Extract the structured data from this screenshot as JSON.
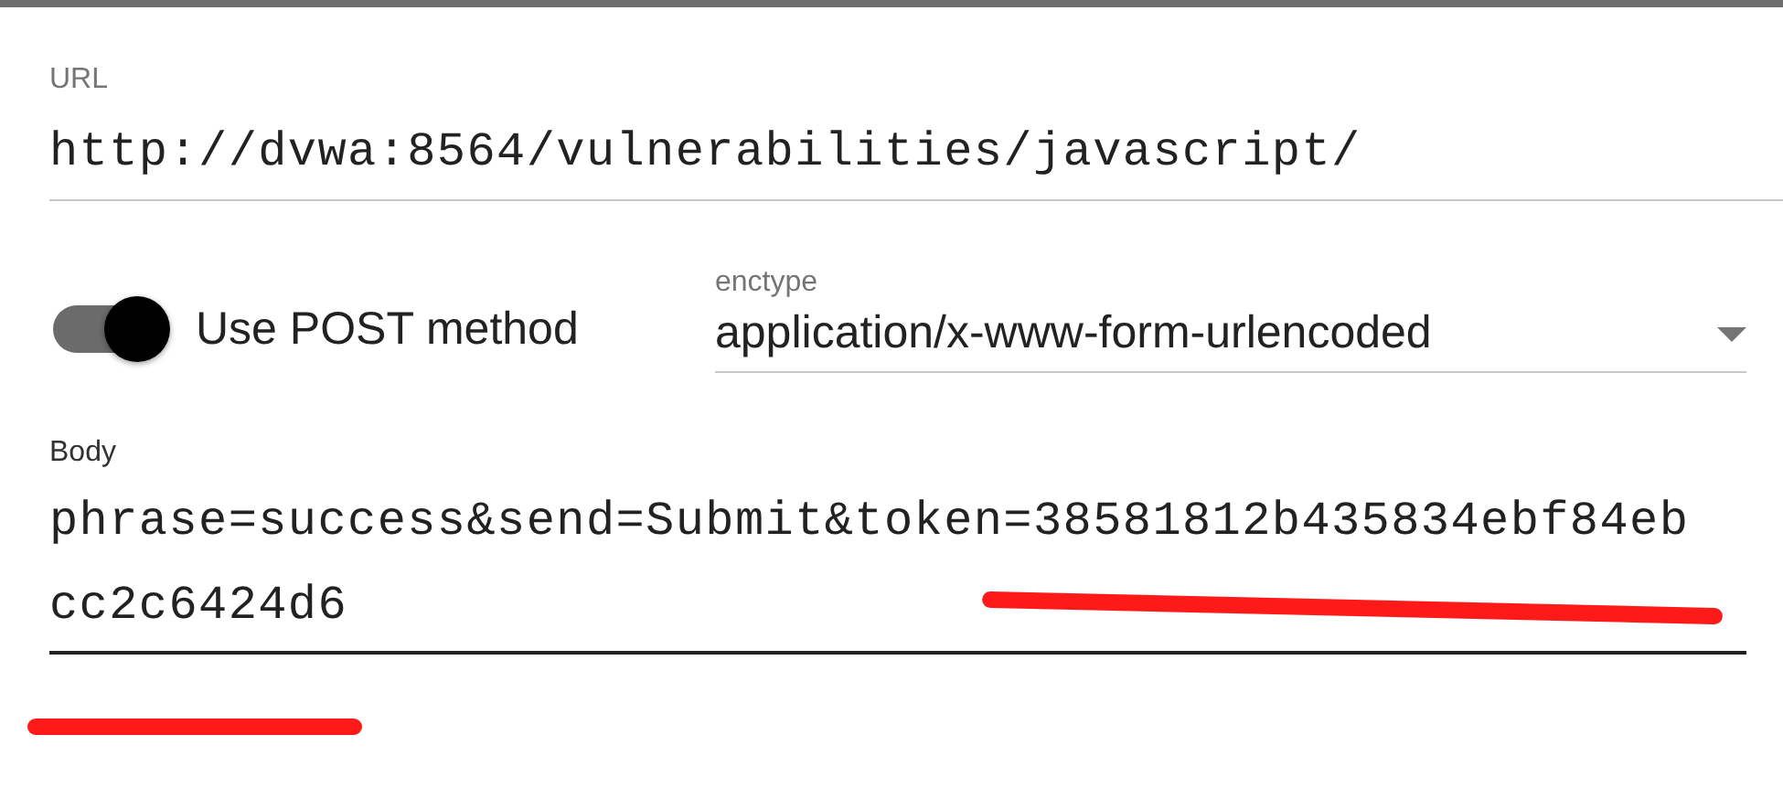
{
  "url": {
    "label": "URL",
    "value": "http://dvwa:8564/vulnerabilities/javascript/"
  },
  "post_toggle": {
    "label": "Use POST method",
    "on": true
  },
  "enctype": {
    "label": "enctype",
    "value": "application/x-www-form-urlencoded"
  },
  "body": {
    "label": "Body",
    "value": "phrase=success&send=Submit&token=38581812b435834ebf84ebcc2c6424d6"
  }
}
